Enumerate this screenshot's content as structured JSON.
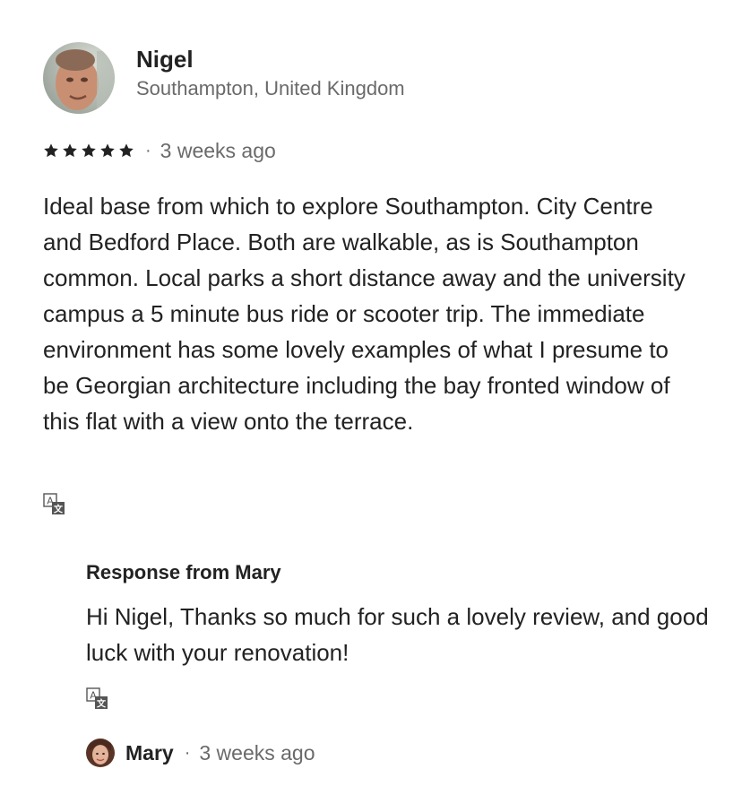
{
  "review": {
    "reviewer_name": "Nigel",
    "reviewer_location": "Southampton, United Kingdom",
    "rating": 5,
    "separator": "·",
    "date": "3 weeks ago",
    "text": "Ideal base from which to explore Southampton. City Centre and Bedford Place. Both are walkable, as is Southampton common. Local parks a short distance away and the university campus a 5 minute bus ride or scooter trip. The immediate environment has some lovely examples of what I presume to be Georgian architecture including the bay fronted window of this flat with a view onto the terrace.",
    "translate_icon": "translate-icon"
  },
  "response": {
    "title": "Response from Mary",
    "text": "Hi Nigel, Thanks so much for such a lovely review, and good luck with your renovation!",
    "translate_icon": "translate-icon",
    "host_name": "Mary",
    "separator": "·",
    "date": "3 weeks ago"
  },
  "colors": {
    "primary_text": "#222222",
    "secondary_text": "#6a6a6a",
    "star": "#222222"
  }
}
